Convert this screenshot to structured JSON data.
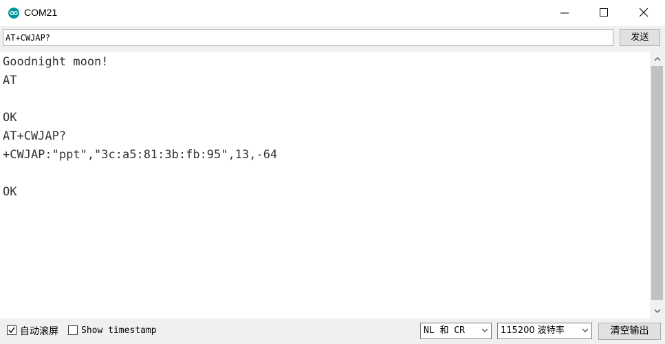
{
  "window": {
    "title": "COM21",
    "icon": "arduino-logo-icon"
  },
  "input": {
    "value": "AT+CWJAP?",
    "send_label": "发送"
  },
  "output": {
    "lines": [
      "Goodnight moon!",
      "AT",
      "",
      "OK",
      "AT+CWJAP?",
      "+CWJAP:\"ppt\",\"3c:a5:81:3b:fb:95\",13,-64",
      "",
      "OK"
    ]
  },
  "footer": {
    "autoscroll_label": "自动滚屏",
    "autoscroll_checked": true,
    "timestamp_label": "Show timestamp",
    "timestamp_checked": false,
    "line_ending": "NL 和 CR",
    "baud_rate": "115200 波特率",
    "clear_label": "清空输出"
  },
  "colors": {
    "accent": "#00979c",
    "panel": "#f0f0f0",
    "button": "#e1e1e1"
  }
}
